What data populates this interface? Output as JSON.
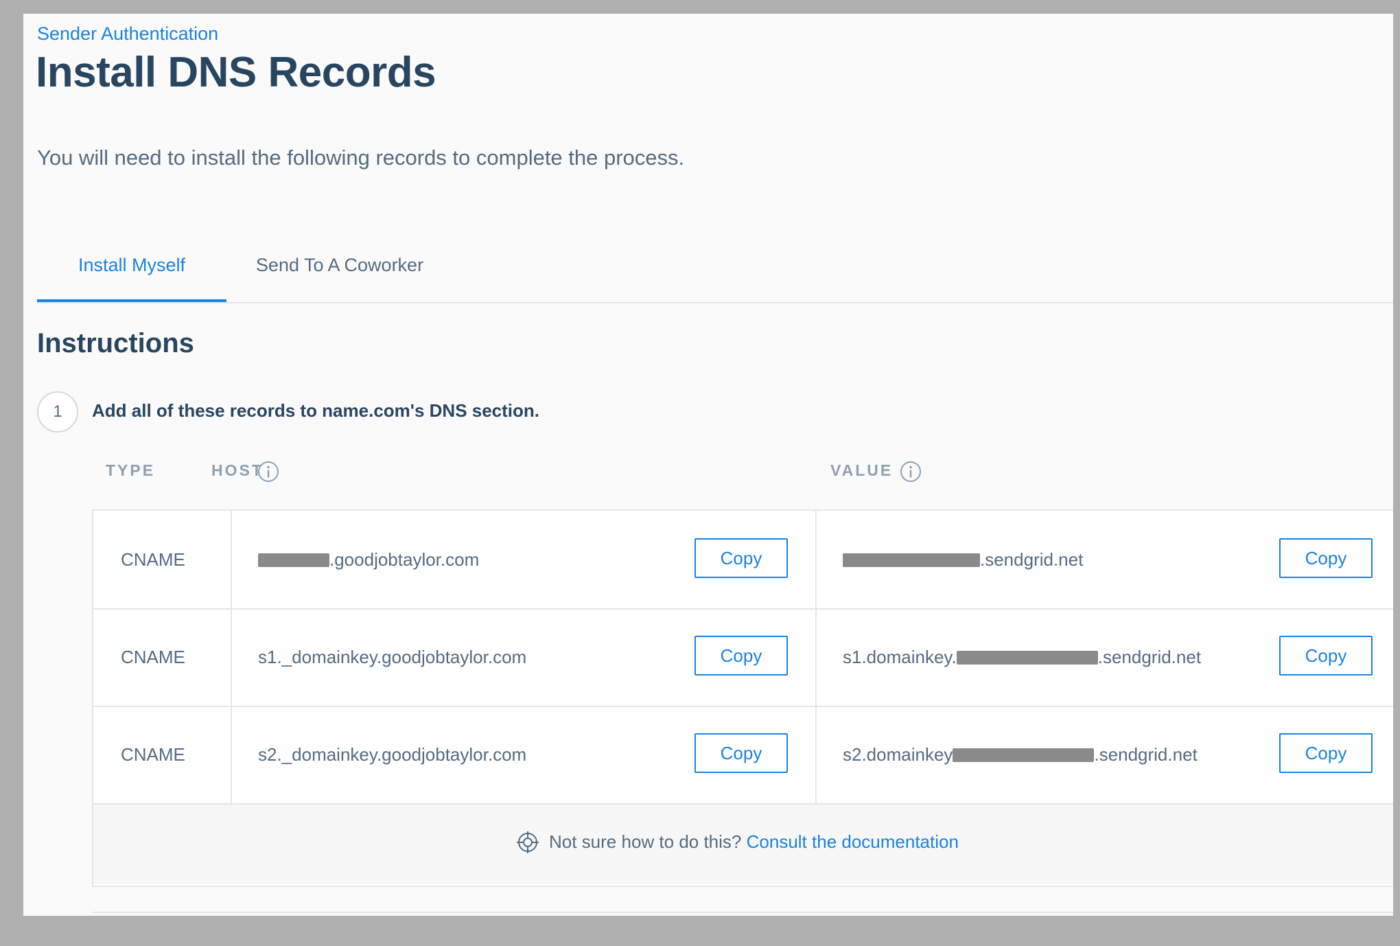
{
  "breadcrumb": "Sender Authentication",
  "page_title": "Install DNS Records",
  "intro": "You will need to install the following records to complete the process.",
  "tabs": [
    {
      "label": "Install Myself",
      "active": true
    },
    {
      "label": "Send To A Coworker",
      "active": false
    }
  ],
  "instructions": {
    "heading": "Instructions",
    "step_number": "1",
    "step_text": "Add all of these records to name.com's DNS section."
  },
  "table": {
    "headers": {
      "type": "TYPE",
      "host": "HOST",
      "value": "VALUE"
    },
    "copy_label": "Copy",
    "rows": [
      {
        "type": "CNAME",
        "host_prefix": "",
        "host_suffix": ".goodjobtaylor.com",
        "value_prefix": "",
        "value_suffix": ".sendgrid.net"
      },
      {
        "type": "CNAME",
        "host_prefix": "s1._domainkey.goodjobtaylor.com",
        "host_suffix": "",
        "value_prefix": "s1.domainkey.",
        "value_suffix": ".sendgrid.net"
      },
      {
        "type": "CNAME",
        "host_prefix": "s2._domainkey.goodjobtaylor.com",
        "host_suffix": "",
        "value_prefix": "s2.domainkey",
        "value_suffix": ".sendgrid.net"
      }
    ]
  },
  "help": {
    "text": "Not sure how to do this?",
    "link": "Consult the documentation",
    "icon": "lifebuoy-icon"
  },
  "colors": {
    "accent": "#1a82e2",
    "heading": "#294661",
    "body_text": "#546b81",
    "border": "#e3e6ea"
  }
}
